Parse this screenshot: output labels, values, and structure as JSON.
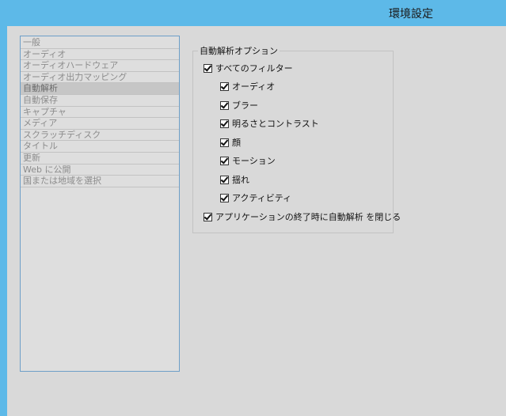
{
  "window": {
    "title": "環境設定"
  },
  "categories": [
    {
      "label": "一般",
      "selected": false
    },
    {
      "label": "オーディオ",
      "selected": false
    },
    {
      "label": "オーディオハードウェア",
      "selected": false
    },
    {
      "label": "オーディオ出力マッピング",
      "selected": false
    },
    {
      "label": "自動解析",
      "selected": true
    },
    {
      "label": "自動保存",
      "selected": false
    },
    {
      "label": "キャプチャ",
      "selected": false
    },
    {
      "label": "メディア",
      "selected": false
    },
    {
      "label": "スクラッチディスク",
      "selected": false
    },
    {
      "label": "タイトル",
      "selected": false
    },
    {
      "label": "更新",
      "selected": false
    },
    {
      "label": "Web に公開",
      "selected": false
    },
    {
      "label": "国または地域を選択",
      "selected": false
    }
  ],
  "auto_analysis": {
    "group_title": "自動解析オプション",
    "all_filters": {
      "label": "すべてのフィルター",
      "checked": true
    },
    "filters": [
      {
        "label": "オーディオ",
        "checked": true
      },
      {
        "label": "ブラー",
        "checked": true
      },
      {
        "label": "明るさとコントラスト",
        "checked": true
      },
      {
        "label": "顔",
        "checked": true
      },
      {
        "label": "モーション",
        "checked": true
      },
      {
        "label": "揺れ",
        "checked": true
      },
      {
        "label": "アクティビティ",
        "checked": true
      }
    ],
    "close_on_exit": {
      "label": "アプリケーションの終了時に自動解析 を閉じる",
      "checked": true
    }
  }
}
